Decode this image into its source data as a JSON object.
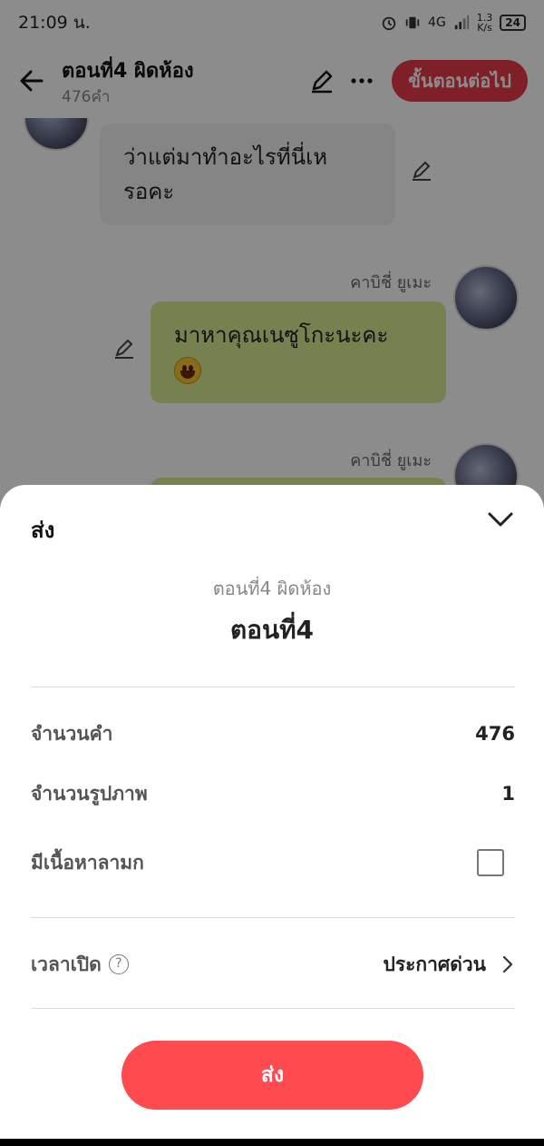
{
  "status_bar": {
    "time": "21:09 น.",
    "network": "4G",
    "speed_value": "1.3",
    "speed_unit": "K/s",
    "battery": "24"
  },
  "header": {
    "title": "ตอนที่4 ผิดห้อง",
    "word_count": "476คำ",
    "next_button": "ขั้นตอนต่อไป"
  },
  "chat": {
    "messages": [
      {
        "side": "left",
        "text_line1": "ว่าแต่มาทำอะไรที่นี่เห",
        "text_line2": "รอคะ"
      },
      {
        "side": "right",
        "sender": "คาบิชี่ ยูเมะ",
        "text": "มาหาคุณเนซูโกะนะคะ"
      },
      {
        "side": "right",
        "sender": "คาบิชี่ ยูเมะ"
      }
    ]
  },
  "sheet": {
    "title": "ส่ง",
    "episode_name": "ตอนที่4 ผิดห้อง",
    "episode_short": "ตอนที่4",
    "rows": {
      "word_count_label": "จำนวนคำ",
      "word_count_value": "476",
      "image_count_label": "จำนวนรูปภาพ",
      "image_count_value": "1",
      "adult_label": "มีเนื้อหาลามก",
      "adult_checked": false,
      "open_time_label": "เวลาเปิด",
      "help_glyph": "?",
      "open_time_value": "ประกาศด่วน"
    },
    "send_button": "ส่ง"
  },
  "colors": {
    "accent": "#ff4a50",
    "header_button": "#e8394a",
    "bubble_right": "#d6ec90",
    "bubble_left": "#f3f3f3"
  },
  "icons": [
    "back-arrow-icon",
    "pencil-icon",
    "more-icon",
    "chevron-down-icon",
    "help-icon",
    "chevron-right-icon",
    "emoji-icon"
  ]
}
